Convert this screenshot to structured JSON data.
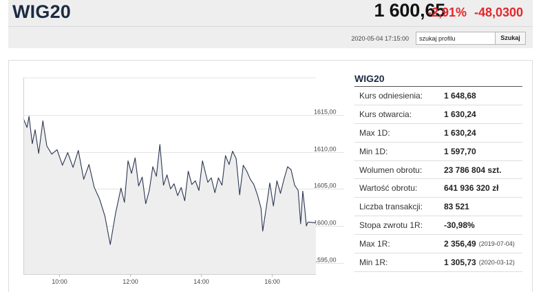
{
  "header": {
    "title": "WIG20",
    "price": "1 600,65",
    "change_pct": "-2,91%",
    "change_abs": "-48,0300",
    "timestamp": "2020-05-04 17:15:00",
    "search_value": "szukaj profilu",
    "search_button": "Szukaj"
  },
  "colors": {
    "title": "#1c2b43",
    "negative": "#e3262b",
    "line": "#2a3550",
    "fill": "#eeeeee"
  },
  "chart_data": {
    "type": "area",
    "x_ticks": [
      "10:00",
      "12:00",
      "14:00",
      "16:00"
    ],
    "x_tick_hours": [
      10,
      12,
      14,
      16
    ],
    "y_ticks": [
      1615,
      1610,
      1605,
      1600,
      1595
    ],
    "y_tick_labels": [
      "1615,00",
      "1610,00",
      "1605,00",
      "1600,00",
      "1595,00"
    ],
    "xlim": [
      9.0,
      17.25
    ],
    "ylim": [
      1593.5,
      1620.0
    ],
    "grid": "horizontal",
    "series": [
      {
        "values": [
          [
            9.0,
            1614.5
          ],
          [
            9.1,
            1613.3
          ],
          [
            9.16,
            1614.8
          ],
          [
            9.25,
            1611.1
          ],
          [
            9.33,
            1613.0
          ],
          [
            9.43,
            1609.8
          ],
          [
            9.55,
            1614.2
          ],
          [
            9.66,
            1610.8
          ],
          [
            9.8,
            1609.7
          ],
          [
            9.95,
            1610.3
          ],
          [
            10.1,
            1608.2
          ],
          [
            10.25,
            1609.9
          ],
          [
            10.4,
            1607.9
          ],
          [
            10.55,
            1610.2
          ],
          [
            10.7,
            1606.3
          ],
          [
            10.85,
            1608.3
          ],
          [
            11.0,
            1605.2
          ],
          [
            11.15,
            1603.6
          ],
          [
            11.3,
            1601.3
          ],
          [
            11.45,
            1597.5
          ],
          [
            11.6,
            1601.7
          ],
          [
            11.75,
            1605.1
          ],
          [
            11.85,
            1603.2
          ],
          [
            11.95,
            1608.8
          ],
          [
            12.05,
            1607.1
          ],
          [
            12.15,
            1609.2
          ],
          [
            12.25,
            1605.4
          ],
          [
            12.35,
            1606.6
          ],
          [
            12.45,
            1603.0
          ],
          [
            12.55,
            1604.8
          ],
          [
            12.65,
            1608.0
          ],
          [
            12.75,
            1606.7
          ],
          [
            12.85,
            1611.0
          ],
          [
            12.95,
            1605.5
          ],
          [
            13.05,
            1606.9
          ],
          [
            13.15,
            1605.0
          ],
          [
            13.25,
            1605.7
          ],
          [
            13.35,
            1604.1
          ],
          [
            13.45,
            1605.2
          ],
          [
            13.55,
            1603.4
          ],
          [
            13.65,
            1607.4
          ],
          [
            13.75,
            1605.6
          ],
          [
            13.85,
            1606.1
          ],
          [
            13.95,
            1604.8
          ],
          [
            14.05,
            1608.8
          ],
          [
            14.2,
            1605.9
          ],
          [
            14.3,
            1606.5
          ],
          [
            14.4,
            1604.5
          ],
          [
            14.5,
            1606.5
          ],
          [
            14.6,
            1605.5
          ],
          [
            14.7,
            1609.5
          ],
          [
            14.8,
            1608.3
          ],
          [
            14.9,
            1610.1
          ],
          [
            15.0,
            1609.1
          ],
          [
            15.1,
            1604.2
          ],
          [
            15.2,
            1608.2
          ],
          [
            15.3,
            1607.4
          ],
          [
            15.4,
            1606.3
          ],
          [
            15.5,
            1605.6
          ],
          [
            15.6,
            1604.2
          ],
          [
            15.7,
            1602.4
          ],
          [
            15.75,
            1599.3
          ],
          [
            15.85,
            1602.5
          ],
          [
            15.95,
            1605.8
          ],
          [
            16.05,
            1602.7
          ],
          [
            16.15,
            1606.1
          ],
          [
            16.25,
            1604.4
          ],
          [
            16.35,
            1606.3
          ],
          [
            16.45,
            1608.0
          ],
          [
            16.55,
            1607.6
          ],
          [
            16.65,
            1605.5
          ],
          [
            16.75,
            1604.8
          ],
          [
            16.82,
            1600.3
          ],
          [
            16.88,
            1604.7
          ],
          [
            16.93,
            1602.6
          ],
          [
            16.98,
            1600.0
          ],
          [
            17.02,
            1600.5
          ],
          [
            17.1,
            1600.5
          ],
          [
            17.25,
            1600.4
          ]
        ]
      }
    ]
  },
  "info": {
    "title": "WIG20",
    "rows": [
      {
        "label": "Kurs odniesienia:",
        "value": "1 648,68",
        "note": ""
      },
      {
        "label": "Kurs otwarcia:",
        "value": "1 630,24",
        "note": ""
      },
      {
        "label": "Max 1D:",
        "value": "1 630,24",
        "note": ""
      },
      {
        "label": "Min 1D:",
        "value": "1 597,70",
        "note": ""
      },
      {
        "label": "Wolumen obrotu:",
        "value": "23 786 804 szt.",
        "note": ""
      },
      {
        "label": "Wartość obrotu:",
        "value": "641 936 320 zł",
        "note": ""
      },
      {
        "label": "Liczba transakcji:",
        "value": "83 521",
        "note": ""
      },
      {
        "label": "Stopa zwrotu 1R:",
        "value": "-30,98%",
        "note": ""
      },
      {
        "label": "Max 1R:",
        "value": "2 356,49",
        "note": "(2019-07-04)"
      },
      {
        "label": "Min 1R:",
        "value": "1 305,73",
        "note": "(2020-03-12)"
      }
    ]
  }
}
